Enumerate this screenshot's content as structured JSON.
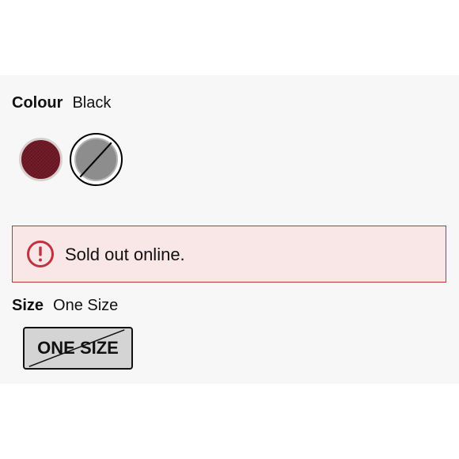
{
  "colour": {
    "label": "Colour",
    "selected_value": "Black",
    "swatches": [
      {
        "name": "red",
        "color": "#6e1624",
        "available": true,
        "selected": false
      },
      {
        "name": "black",
        "color": "#8d8d8d",
        "available": false,
        "selected": true
      }
    ]
  },
  "alert": {
    "icon": "exclamation-circle-icon",
    "message": "Sold out online.",
    "border_color": "#c0323f",
    "background_color": "#f9e6e7"
  },
  "size": {
    "label": "Size",
    "selected_value": "One Size",
    "options": [
      {
        "label": "ONE SIZE",
        "available": false,
        "selected": true
      }
    ]
  }
}
